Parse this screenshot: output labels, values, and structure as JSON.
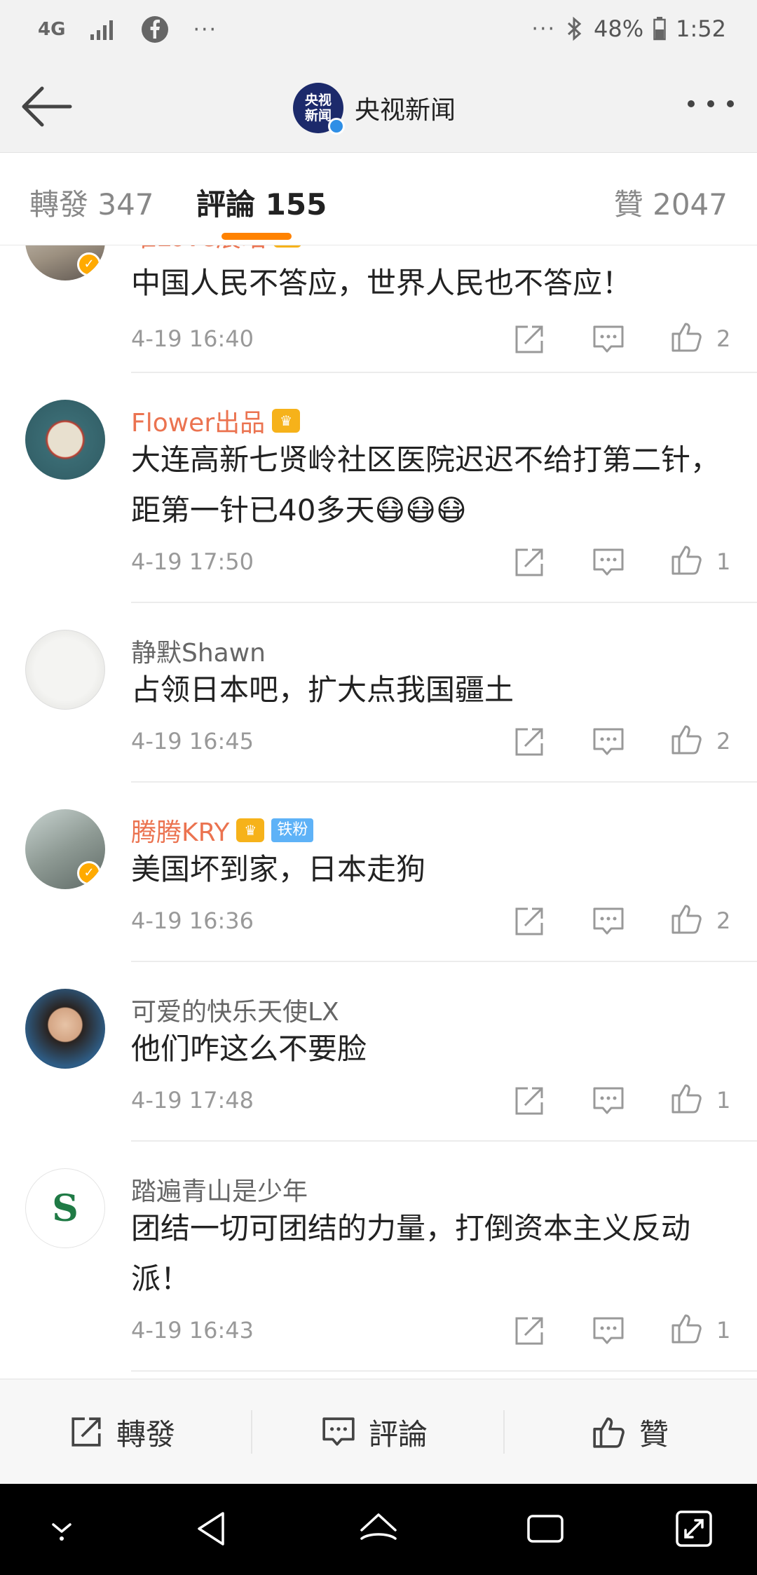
{
  "status_bar": {
    "network": "4G",
    "more": "···",
    "right_more": "···",
    "battery": "48%",
    "time": "1:52"
  },
  "nav": {
    "logo_text_line1": "央视",
    "logo_text_line2": "新闻",
    "title": "央视新闻"
  },
  "tabs": {
    "repost": "轉發 347",
    "comments": "評論 155",
    "likes": "贊 2047"
  },
  "comments": [
    {
      "user": "唯Love展昭",
      "text": "中国人民不答应，世界人民也不答应！",
      "time": "4-19 16:40",
      "likes": "2"
    },
    {
      "user": "Flower出品",
      "text": "大连高新七贤岭社区医院迟迟不给打第二针，距第一针已40多天😷😷😷",
      "time": "4-19 17:50",
      "likes": "1"
    },
    {
      "user": "静默Shawn",
      "text": "占领日本吧，扩大点我国疆土",
      "time": "4-19 16:45",
      "likes": "2"
    },
    {
      "user": "腾腾KRY",
      "badge": "铁粉",
      "text": "美国坏到家，日本走狗",
      "time": "4-19 16:36",
      "likes": "2"
    },
    {
      "user": "可爱的快乐天使LX",
      "text": "他们咋这么不要脸",
      "time": "4-19 17:48",
      "likes": "1"
    },
    {
      "user": "踏遍青山是少年",
      "avatar_letter": "S",
      "text": "团结一切可团结的力量，打倒资本主义反动派！",
      "time": "4-19 16:43",
      "likes": "1"
    }
  ],
  "bottom_bar": {
    "repost": "轉發",
    "comment": "評論",
    "like": "贊"
  },
  "colors": {
    "accent": "#ff8200",
    "vip_name": "#eb7350",
    "muted": "#999999"
  }
}
